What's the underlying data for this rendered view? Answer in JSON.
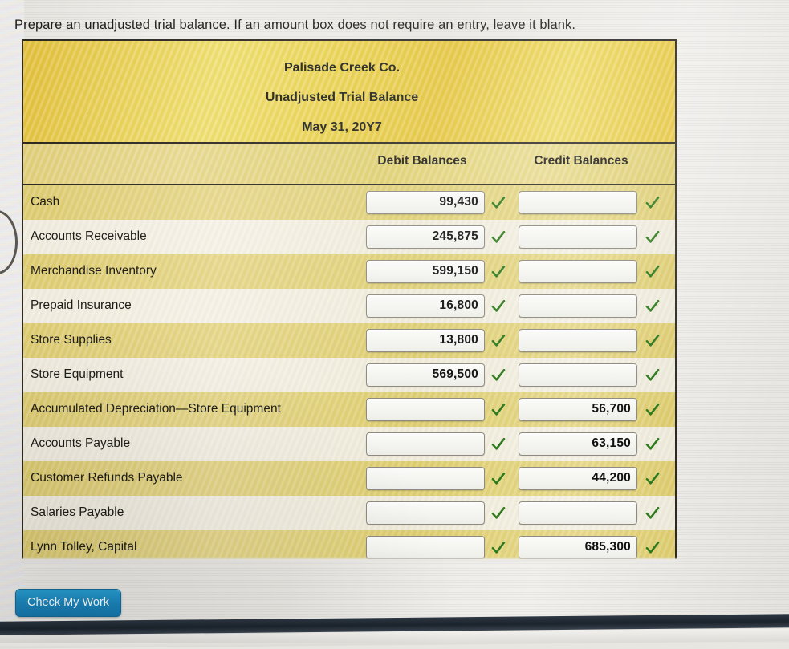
{
  "instruction": "Prepare an unadjusted trial balance. If an amount box does not require an entry, leave it blank.",
  "worksheet": {
    "company": "Palisade Creek Co.",
    "statement": "Unadjusted Trial Balance",
    "date": "May 31, 20Y7",
    "columns": {
      "account": "",
      "debit": "Debit Balances",
      "credit": "Credit Balances"
    },
    "rows": [
      {
        "account": "Cash",
        "debit": "99,430",
        "credit": "",
        "debit_status": "check",
        "credit_status": "check"
      },
      {
        "account": "Accounts Receivable",
        "debit": "245,875",
        "credit": "",
        "debit_status": "check",
        "credit_status": "check"
      },
      {
        "account": "Merchandise Inventory",
        "debit": "599,150",
        "credit": "",
        "debit_status": "check",
        "credit_status": "check"
      },
      {
        "account": "Prepaid Insurance",
        "debit": "16,800",
        "credit": "",
        "debit_status": "check",
        "credit_status": "check"
      },
      {
        "account": "Store Supplies",
        "debit": "13,800",
        "credit": "",
        "debit_status": "check",
        "credit_status": "check"
      },
      {
        "account": "Store Equipment",
        "debit": "569,500",
        "credit": "",
        "debit_status": "check",
        "credit_status": "check"
      },
      {
        "account": "Accumulated Depreciation—Store Equipment",
        "debit": "",
        "credit": "56,700",
        "debit_status": "check",
        "credit_status": "check"
      },
      {
        "account": "Accounts Payable",
        "debit": "",
        "credit": "63,150",
        "debit_status": "check",
        "credit_status": "check"
      },
      {
        "account": "Customer Refunds Payable",
        "debit": "",
        "credit": "44,200",
        "debit_status": "check",
        "credit_status": "check"
      },
      {
        "account": "Salaries Payable",
        "debit": "",
        "credit": "",
        "debit_status": "check",
        "credit_status": "check"
      },
      {
        "account": "Lynn Tolley, Capital",
        "debit": "",
        "credit": "685,300",
        "debit_status": "check",
        "credit_status": "check"
      }
    ]
  },
  "actions": {
    "check_my_work": "Check My Work"
  },
  "colors": {
    "header_gold": "#e4c336",
    "row_gold": "#ddcc73",
    "row_cream": "#eeead9",
    "check_green": "#2f7a1e",
    "button_blue": "#1b86bd",
    "border_dark": "#2e2a22"
  }
}
